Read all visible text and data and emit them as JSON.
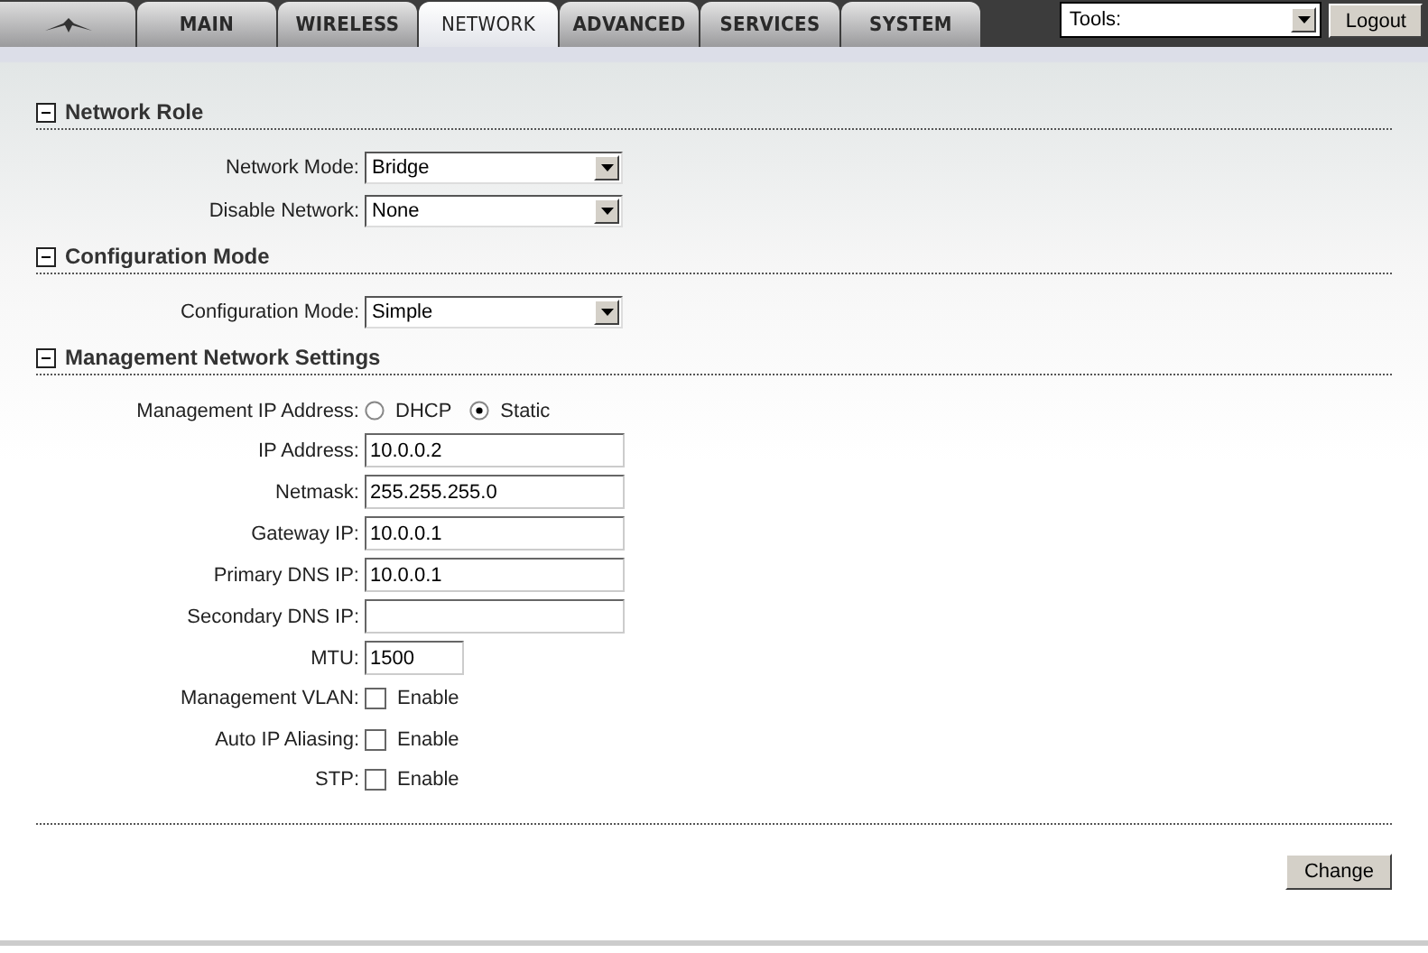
{
  "tabs": [
    {
      "label": "MAIN",
      "selected": false
    },
    {
      "label": "WIRELESS",
      "selected": false
    },
    {
      "label": "NETWORK",
      "selected": true
    },
    {
      "label": "ADVANCED",
      "selected": false
    },
    {
      "label": "SERVICES",
      "selected": false
    },
    {
      "label": "SYSTEM",
      "selected": false
    }
  ],
  "tools": {
    "value": "Tools:"
  },
  "logout": "Logout",
  "sections": [
    {
      "title": "Network Role",
      "expanded": true,
      "rows": [
        {
          "kind": "select",
          "label": "Network Mode:",
          "value": "Bridge"
        },
        {
          "kind": "select",
          "label": "Disable Network:",
          "value": "None"
        }
      ]
    },
    {
      "title": "Configuration Mode",
      "expanded": true,
      "rows": [
        {
          "kind": "select",
          "label": "Configuration Mode:",
          "value": "Simple"
        }
      ]
    },
    {
      "title": "Management Network Settings",
      "expanded": true,
      "rows": [
        {
          "kind": "radio",
          "label": "Management IP Address:",
          "options": [
            {
              "label": "DHCP",
              "selected": false
            },
            {
              "label": "Static",
              "selected": true
            }
          ]
        },
        {
          "kind": "text",
          "label": "IP Address:",
          "value": "10.0.0.2"
        },
        {
          "kind": "text",
          "label": "Netmask:",
          "value": "255.255.255.0"
        },
        {
          "kind": "text",
          "label": "Gateway IP:",
          "value": "10.0.0.1"
        },
        {
          "kind": "text",
          "label": "Primary DNS IP:",
          "value": "10.0.0.1"
        },
        {
          "kind": "text",
          "label": "Secondary DNS IP:"
        },
        {
          "kind": "short-text",
          "label": "MTU:",
          "value": "1500"
        },
        {
          "kind": "checkbox",
          "label": "Management VLAN:",
          "option": "Enable",
          "checked": false
        },
        {
          "kind": "checkbox",
          "label": "Auto IP Aliasing:",
          "option": "Enable",
          "checked": false
        },
        {
          "kind": "checkbox",
          "label": "STP:",
          "option": "Enable",
          "checked": false
        }
      ]
    }
  ],
  "change_button": "Change"
}
